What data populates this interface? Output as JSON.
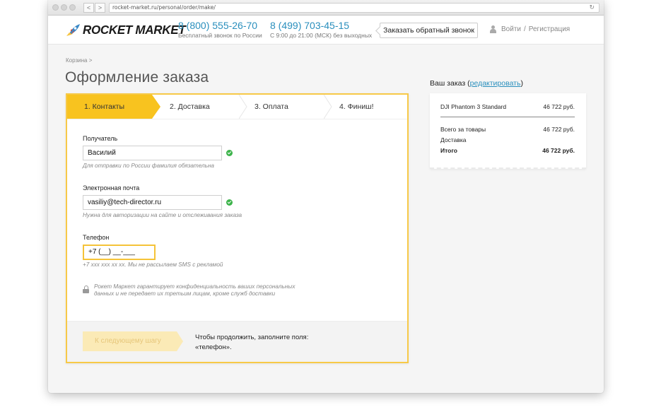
{
  "browser": {
    "url": "rocket-market.ru/personal/order/make/",
    "back_label": "<",
    "forward_label": ">",
    "reload_label": "↻"
  },
  "header": {
    "logo_text": "ROCKET MARKET",
    "phones": [
      {
        "number": "8 (800) 555-26-70",
        "sub": "Бесплатный звонок по России"
      },
      {
        "number": "8 (499) 703-45-15",
        "sub": "С 9:00 до 21:00 (МСК) без выходных"
      }
    ],
    "callback_label": "Заказать обратный звонок",
    "login_label": "Войти",
    "auth_separator": "/",
    "register_label": "Регистрация"
  },
  "breadcrumb": "Корзина >",
  "page_title": "Оформление заказа",
  "steps": [
    {
      "label": "1. Контакты",
      "active": true
    },
    {
      "label": "2. Доставка",
      "active": false
    },
    {
      "label": "3. Оплата",
      "active": false
    },
    {
      "label": "4. Финиш!",
      "active": false
    }
  ],
  "form": {
    "recipient": {
      "label": "Получатель",
      "value": "Василий",
      "hint": "Для отправки по России фамилия обязательна"
    },
    "email": {
      "label": "Электронная почта",
      "value": "vasiliy@tech-director.ru",
      "hint": "Нужна для авторизации на сайте и отслеживания заказа"
    },
    "phone": {
      "label": "Телефон",
      "value": "+7 (__) __-___",
      "hint": "+7 xxx xxx xx xx. Мы не рассылаем SMS с рекламой"
    },
    "privacy_note": "Рокет Маркет гарантирует конфиденциальность ваших персональных данных и не передает их третьим лицам, кроме служб доставки",
    "next_button": "К следующему шагу",
    "footer_note_line1": "Чтобы продолжить, заполните поля:",
    "footer_note_line2": "«телефон»."
  },
  "order": {
    "title": "Ваш заказ (",
    "edit_link": "редактировать",
    "title_end": ")",
    "item_name": "DJI Phantom 3 Standard",
    "item_price": "46 722 руб.",
    "subtotal_label": "Всего за товары",
    "subtotal_value": "46 722 руб.",
    "delivery_label": "Доставка",
    "delivery_value": "",
    "total_label": "Итого",
    "total_value": "46 722 руб."
  },
  "colors": {
    "accent": "#f8c31f",
    "link": "#2a8fbd",
    "success": "#3cb34a"
  }
}
